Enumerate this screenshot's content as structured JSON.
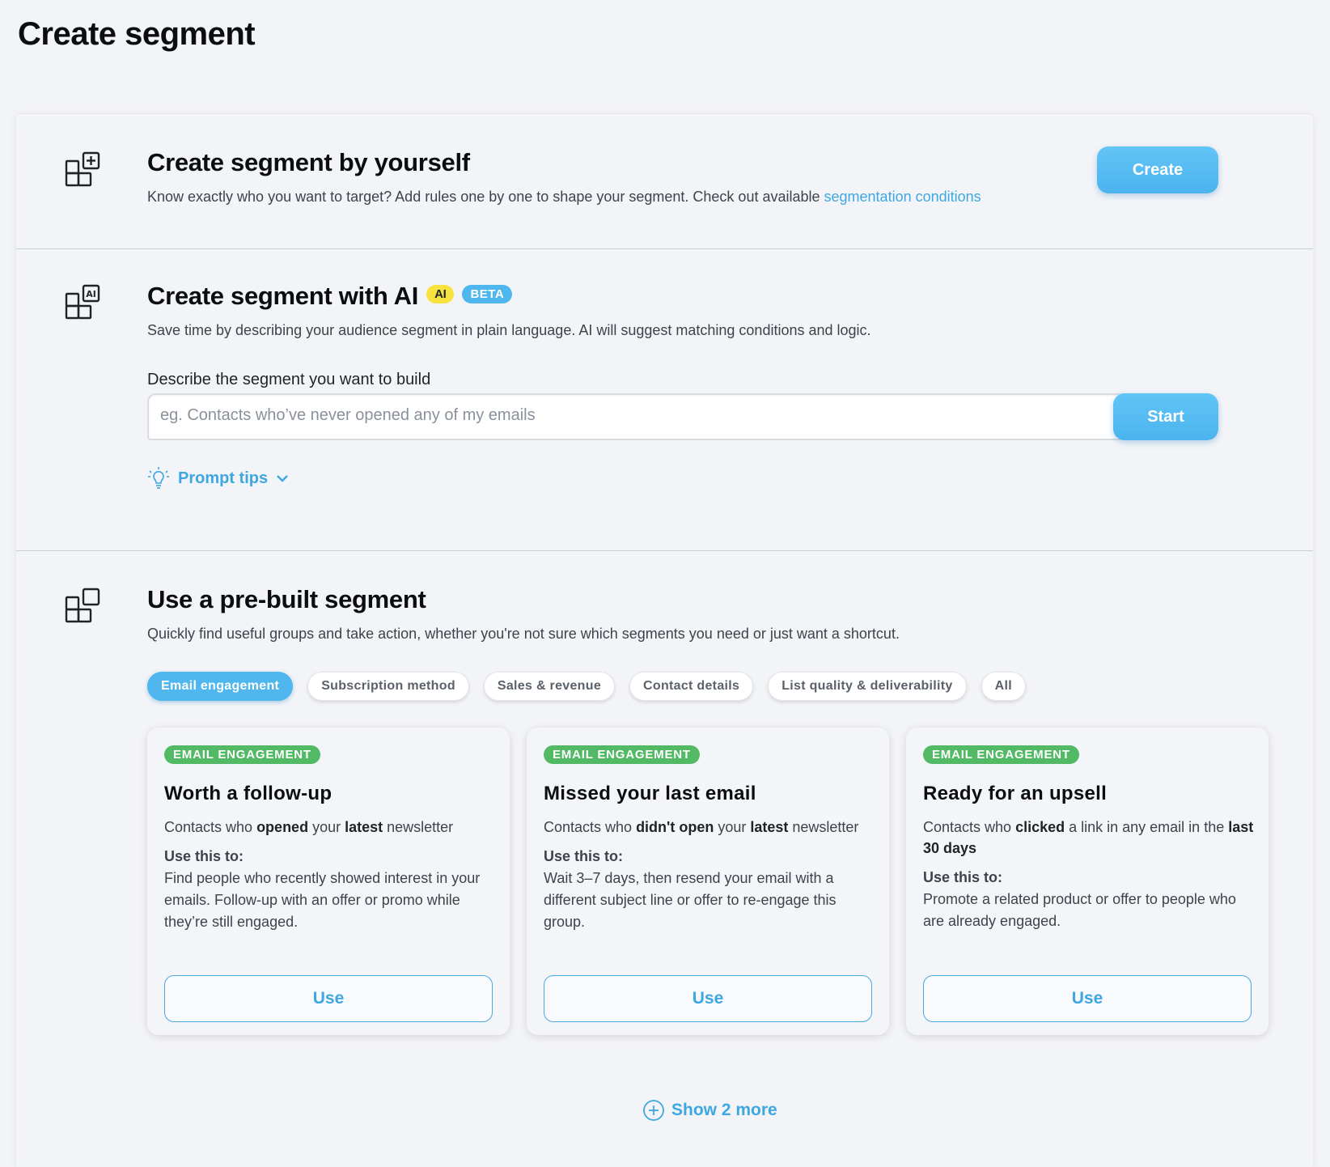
{
  "page": {
    "title": "Create segment"
  },
  "manual": {
    "title": "Create segment by yourself",
    "description": "Know exactly who you want to target? Add rules one by one to shape your segment. Check out available ",
    "link_text": "segmentation conditions",
    "button": "Create",
    "icon": "grid-plus-icon"
  },
  "ai": {
    "title": "Create segment with AI",
    "badge_ai": "AI",
    "badge_beta": "BETA",
    "description": "Save time by describing your audience segment in plain language. AI will suggest matching conditions and logic.",
    "field_label": "Describe the segment you want to build",
    "placeholder": "eg. Contacts who’ve never opened any of my emails",
    "button": "Start",
    "tips_label": "Prompt tips",
    "icon": "grid-ai-icon"
  },
  "prebuilt": {
    "title": "Use a pre-built segment",
    "description": "Quickly find useful groups and take action, whether you're not sure which segments you need or just want a shortcut.",
    "icon": "grid-square-icon",
    "filters": [
      {
        "label": "Email engagement",
        "active": true
      },
      {
        "label": "Subscription method",
        "active": false
      },
      {
        "label": "Sales & revenue",
        "active": false
      },
      {
        "label": "Contact details",
        "active": false
      },
      {
        "label": "List quality & deliverability",
        "active": false
      },
      {
        "label": "All",
        "active": false
      }
    ],
    "cards": [
      {
        "tag": "EMAIL ENGAGEMENT",
        "title": "Worth a follow-up",
        "desc_parts": [
          "Contacts who ",
          "opened",
          " your ",
          "latest",
          " newsletter"
        ],
        "use_label": "Use this to:",
        "body": "Find people who recently showed interest in your emails. Follow-up with an offer or promo while they’re still engaged.",
        "button": "Use"
      },
      {
        "tag": "EMAIL ENGAGEMENT",
        "title": "Missed your last email",
        "desc_parts": [
          "Contacts who ",
          "didn't open",
          " your ",
          "latest",
          " newsletter"
        ],
        "use_label": "Use this to:",
        "body": "Wait 3–7 days, then resend your email with a different subject line or offer to re-engage this group.",
        "button": "Use"
      },
      {
        "tag": "EMAIL ENGAGEMENT",
        "title": "Ready for an upsell",
        "desc_parts": [
          "Contacts who ",
          "clicked",
          " a link in any email in the ",
          "last 30 days",
          ""
        ],
        "use_label": "Use this to:",
        "body": "Promote a related product or offer to people who are already engaged.",
        "button": "Use"
      }
    ],
    "show_more": "Show 2 more"
  },
  "colors": {
    "accent": "#4fb6ee",
    "tag_green": "#52b965",
    "badge_yellow": "#f7e23f"
  }
}
